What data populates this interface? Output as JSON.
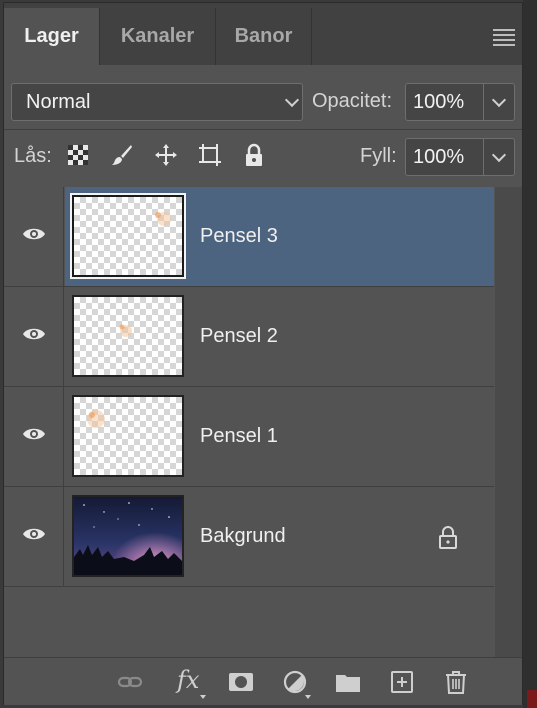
{
  "tabs": [
    {
      "label": "Lager",
      "active": true
    },
    {
      "label": "Kanaler",
      "active": false
    },
    {
      "label": "Banor",
      "active": false
    }
  ],
  "blend_mode": {
    "value": "Normal"
  },
  "opacity": {
    "label": "Opacitet:",
    "value": "100%"
  },
  "lock": {
    "label": "Lås:",
    "icons": [
      "lock-transparent-pixels-icon",
      "lock-image-pixels-icon",
      "lock-position-icon",
      "lock-artboard-icon",
      "lock-all-icon"
    ]
  },
  "fill": {
    "label": "Fyll:",
    "value": "100%"
  },
  "layers": [
    {
      "name": "Pensel 3",
      "visible": true,
      "selected": true,
      "locked": false
    },
    {
      "name": "Pensel 2",
      "visible": true,
      "selected": false,
      "locked": false
    },
    {
      "name": "Pensel 1",
      "visible": true,
      "selected": false,
      "locked": false
    },
    {
      "name": "Bakgrund",
      "visible": true,
      "selected": false,
      "locked": true
    }
  ],
  "footer_icons": [
    "link-layers-icon",
    "fx-icon",
    "add-mask-icon",
    "adjustment-layer-icon",
    "new-group-icon",
    "new-layer-icon",
    "trash-icon"
  ],
  "colors": {
    "panel": "#535353",
    "selected_row": "#4d6480",
    "tab_bar": "#414141"
  }
}
